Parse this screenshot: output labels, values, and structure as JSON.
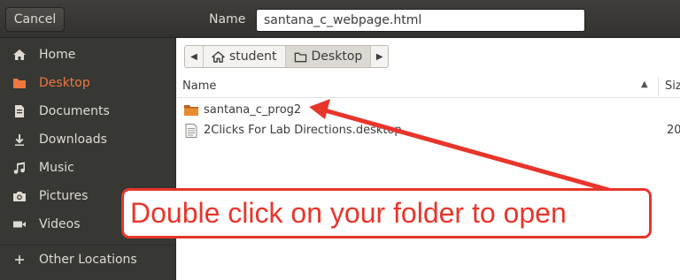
{
  "header": {
    "cancel_label": "Cancel",
    "name_label": "Name",
    "filename_value": "santana_c_webpage.html"
  },
  "sidebar": {
    "items": [
      {
        "label": "Home",
        "icon": "home-icon"
      },
      {
        "label": "Desktop",
        "icon": "folder-icon",
        "active": true
      },
      {
        "label": "Documents",
        "icon": "document-icon"
      },
      {
        "label": "Downloads",
        "icon": "download-icon"
      },
      {
        "label": "Music",
        "icon": "music-icon"
      },
      {
        "label": "Pictures",
        "icon": "camera-icon"
      },
      {
        "label": "Videos",
        "icon": "video-icon"
      },
      {
        "label": "Other Locations",
        "icon": "plus-icon"
      }
    ]
  },
  "pathbar": {
    "segments": [
      {
        "label": "student",
        "icon": "home-icon"
      },
      {
        "label": "Desktop",
        "icon": "folder-icon",
        "current": true
      }
    ]
  },
  "file_list": {
    "columns": {
      "name": "Name",
      "size": "Siz"
    },
    "rows": [
      {
        "name": "santana_c_prog2",
        "icon": "folder-icon",
        "size": ""
      },
      {
        "name": "2Clicks For Lab Directions.desktop",
        "icon": "text-file-icon",
        "size": "20"
      }
    ]
  },
  "annotation": {
    "text": "Double click on your folder to open"
  },
  "colors": {
    "sidebar_bg": "#373733",
    "header_bg": "#3a3935",
    "active_accent": "#f0773f",
    "annotation_red": "#e8352b"
  }
}
